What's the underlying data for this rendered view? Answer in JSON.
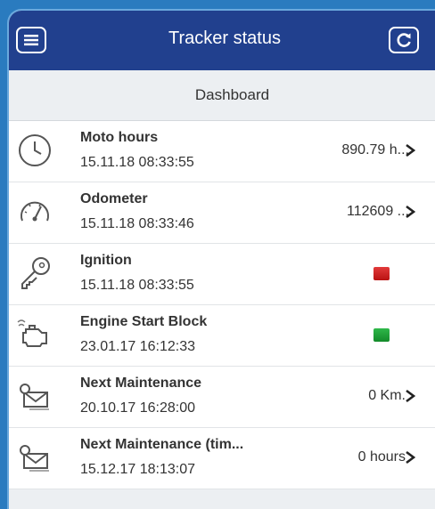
{
  "header": {
    "title": "Tracker status",
    "menu_icon": "menu-icon",
    "refresh_icon": "refresh-icon"
  },
  "subheader": {
    "title": "Dashboard"
  },
  "rows": [
    {
      "icon": "clock-icon",
      "name": "Moto hours",
      "time": "15.11.18 08:33:55",
      "value": "890.79 h...",
      "chevron": true
    },
    {
      "icon": "speedometer-icon",
      "name": "Odometer",
      "time": "15.11.18 08:33:46",
      "value": "112609 ...",
      "chevron": true
    },
    {
      "icon": "key-icon",
      "name": "Ignition",
      "time": "15.11.18 08:33:55",
      "status": "red",
      "status_color": "#d32626"
    },
    {
      "icon": "engine-icon",
      "name": "Engine Start Block",
      "time": "23.01.17 16:12:33",
      "status": "green",
      "status_color": "#22a83c"
    },
    {
      "icon": "maintenance-icon",
      "name": "Next Maintenance",
      "time": "20.10.17 16:28:00",
      "value": "0 Km.",
      "chevron": true
    },
    {
      "icon": "maintenance-icon",
      "name": "Next Maintenance (tim...",
      "time": "15.12.17 18:13:07",
      "value": "0 hours",
      "chevron": true
    }
  ],
  "colors": {
    "header_bg": "#21408e",
    "background": "#2a7bbf"
  }
}
